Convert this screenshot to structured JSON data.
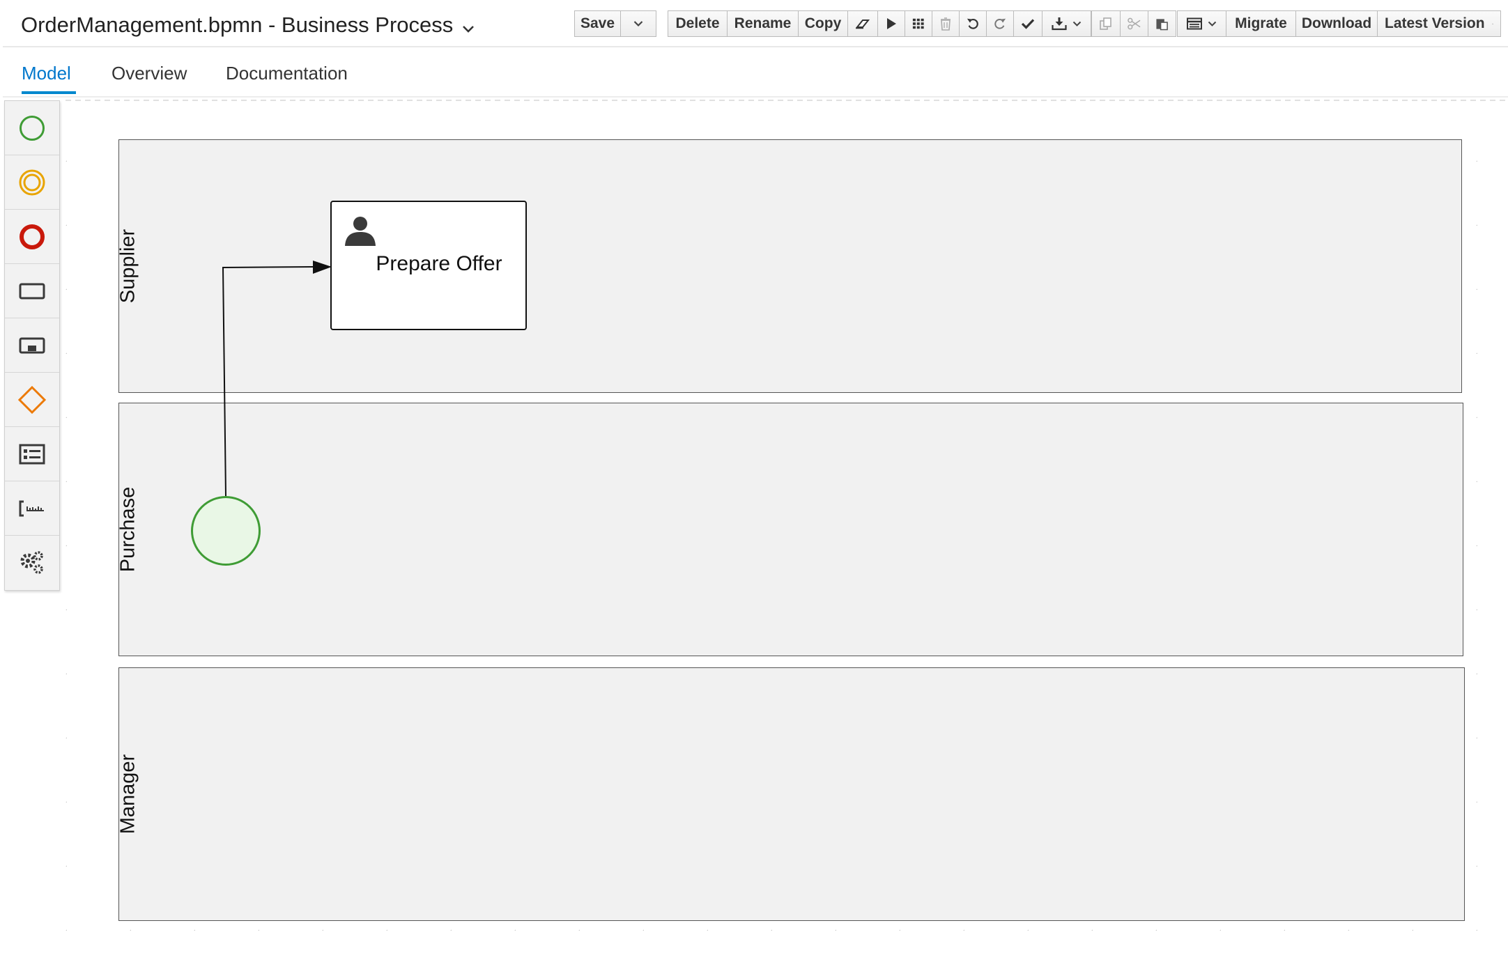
{
  "header": {
    "title": "OrderManagement.bpmn - Business Process",
    "title_dropdown_icon": "chevron-down-icon"
  },
  "toolbar": {
    "save_label": "Save",
    "save_dropdown_icon": "chevron-down-icon",
    "delete_label": "Delete",
    "rename_label": "Rename",
    "copy_label": "Copy",
    "icon_buttons": [
      "eraser-icon",
      "play-icon",
      "grid-icon",
      "trash-icon",
      "undo-icon",
      "redo-icon",
      "check-icon",
      "download-icon",
      "copy-icon",
      "cut-icon",
      "paste-icon",
      "view-icon"
    ],
    "migrate_label": "Migrate",
    "download_label": "Download",
    "version_label": "Latest Version"
  },
  "tabs": [
    {
      "label": "Model",
      "active": true
    },
    {
      "label": "Overview",
      "active": false
    },
    {
      "label": "Documentation",
      "active": false
    }
  ],
  "palette": {
    "items": [
      "start-event-icon",
      "intermediate-event-icon",
      "end-event-icon",
      "task-icon",
      "subprocess-icon",
      "gateway-icon",
      "lane-icon",
      "artifact-icon",
      "custom-tasks-icon"
    ]
  },
  "diagram": {
    "lanes": [
      {
        "name": "Supplier"
      },
      {
        "name": "Purchase"
      },
      {
        "name": "Manager"
      }
    ],
    "task": {
      "label": "Prepare Offer",
      "type": "user-task",
      "lane": "Supplier"
    },
    "start_event": {
      "lane": "Purchase"
    },
    "flow": {
      "from": "start-event",
      "to": "Prepare Offer"
    }
  },
  "colors": {
    "accent": "#0088ce",
    "start_event": "#3f9c35",
    "intermediate_event": "#e8a400",
    "end_event": "#c9190b",
    "gateway": "#ec7a08",
    "lane_fill": "#f1f1f1"
  }
}
